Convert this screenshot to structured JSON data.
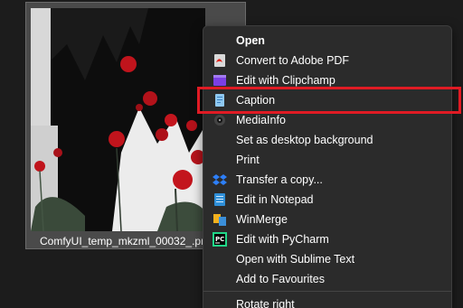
{
  "file": {
    "name": "ComfyUI_temp_mkzml_00032_.png"
  },
  "menu": {
    "items": [
      {
        "label": "Open",
        "icon": "open-icon"
      },
      {
        "label": "Convert to Adobe PDF",
        "icon": "adobe-pdf-icon"
      },
      {
        "label": "Edit with Clipchamp",
        "icon": "clipchamp-icon"
      },
      {
        "label": "Caption",
        "icon": "caption-icon"
      },
      {
        "label": "MediaInfo",
        "icon": "mediainfo-icon"
      },
      {
        "label": "Set as desktop background",
        "icon": ""
      },
      {
        "label": "Print",
        "icon": ""
      },
      {
        "label": "Transfer a copy...",
        "icon": "dropbox-icon"
      },
      {
        "label": "Edit in Notepad",
        "icon": "notepad-icon"
      },
      {
        "label": "WinMerge",
        "icon": "winmerge-icon"
      },
      {
        "label": "Edit with PyCharm",
        "icon": "pycharm-icon"
      },
      {
        "label": "Open with Sublime Text",
        "icon": ""
      },
      {
        "label": "Add to Favourites",
        "icon": ""
      },
      {
        "label": "Rotate right",
        "icon": ""
      }
    ]
  },
  "colors": {
    "highlight": "#e01b24",
    "menu_bg": "#2b2b2b",
    "desktop_bg": "#1c1c1c"
  }
}
